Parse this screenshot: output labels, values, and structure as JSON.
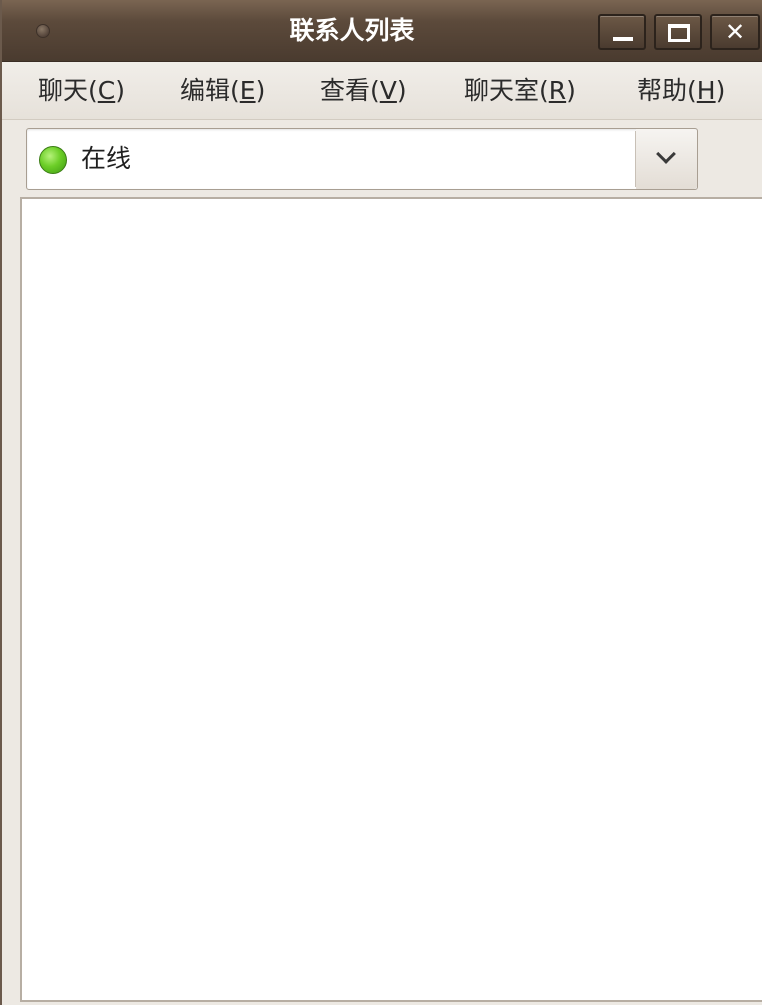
{
  "window": {
    "title": "联系人列表"
  },
  "titlebar": {
    "close_glyph": "✕"
  },
  "menu": {
    "items": [
      {
        "label": "聊天(",
        "mnemonic": "C",
        "suffix": ")"
      },
      {
        "label": "编辑(",
        "mnemonic": "E",
        "suffix": ")"
      },
      {
        "label": "查看(",
        "mnemonic": "V",
        "suffix": ")"
      },
      {
        "label": "聊天室(",
        "mnemonic": "R",
        "suffix": ")"
      },
      {
        "label": "帮助(",
        "mnemonic": "H",
        "suffix": ")"
      }
    ]
  },
  "status": {
    "selected": "在线",
    "indicator_color": "#5cc21d"
  },
  "contacts": []
}
